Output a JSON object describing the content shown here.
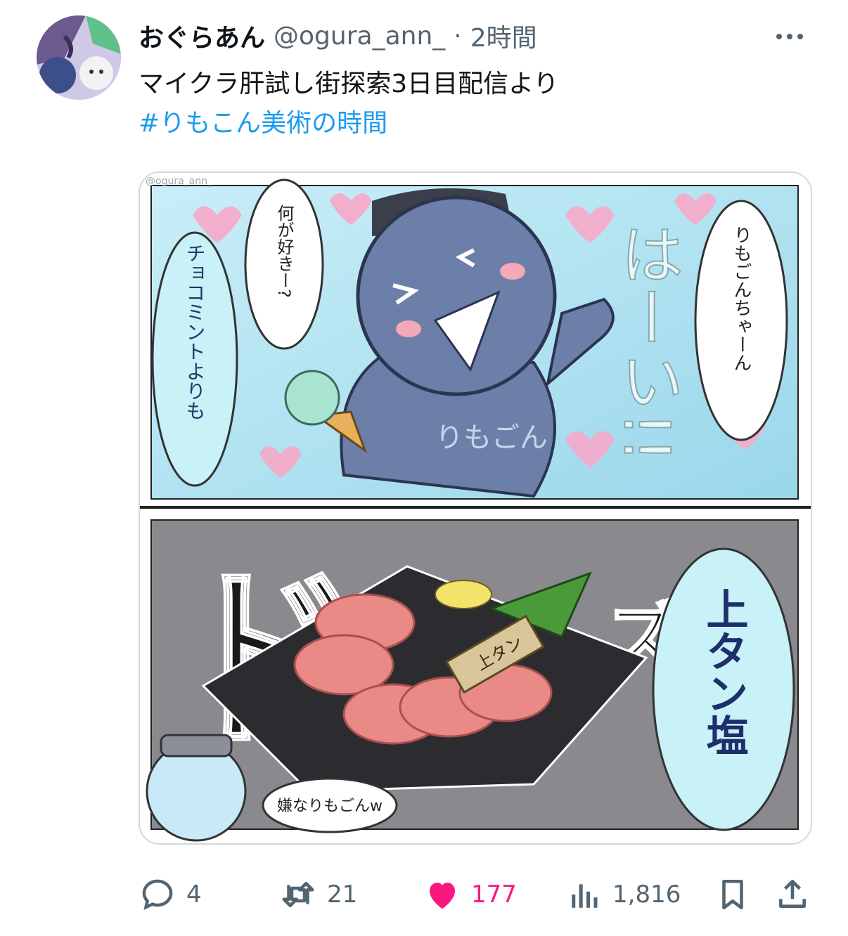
{
  "author": {
    "display_name": "おぐらあん",
    "handle": "@ogura_ann_",
    "separator": "·",
    "time": "2時間"
  },
  "tweet": {
    "text": "マイクラ肝試し街探索3日目配信より",
    "hashtag": "#りもこん美術の時間"
  },
  "image": {
    "watermark": "@ogura_ann_",
    "panel_top": {
      "bubble_right": "りもごんちゃーん",
      "bubble_middle": "何が好きー?",
      "bubble_left": "チョコミントよりも",
      "sfx": "はーい!!",
      "body_text": "りもごん"
    },
    "panel_bottom": {
      "sfx": "ドン",
      "sfx2": "ズ",
      "bubble_right": "上タン塩",
      "bubble_small": "嫌なりもごんw",
      "plate_tag": "上タン"
    }
  },
  "actions": {
    "replies": "4",
    "retweets": "21",
    "likes": "177",
    "views": "1,816"
  },
  "colors": {
    "accent": "#1d9bf0",
    "like": "#f91880",
    "muted": "#536471"
  }
}
